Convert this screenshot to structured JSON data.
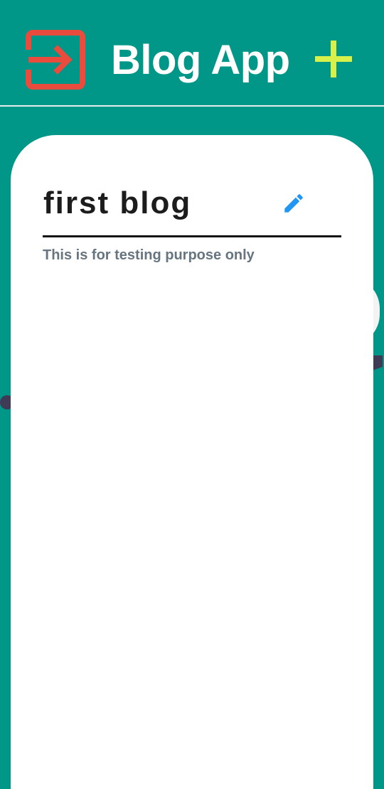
{
  "app_bar": {
    "title": "Blog App",
    "logout_icon": "exit-to-app-icon",
    "add_icon": "plus-icon"
  },
  "blog": {
    "title": "first blog",
    "description": "This is for testing purpose only",
    "edit_icon": "pencil-icon"
  },
  "colors": {
    "primary": "#009688",
    "logout_icon": "#e94b3c",
    "add_icon": "#d7f04a",
    "edit_icon": "#2196f3",
    "card": "#ffffff",
    "title_text": "#1c1c1c",
    "description_text": "#66757f"
  }
}
